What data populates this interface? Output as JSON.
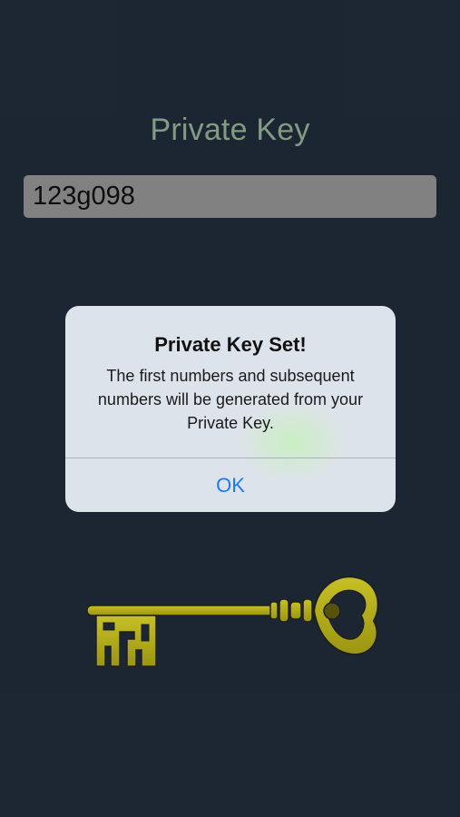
{
  "screen": {
    "title": "Private Key",
    "private_key_value": "123g098"
  },
  "alert": {
    "title": "Private Key Set!",
    "message": "The first numbers and subsequent numbers will be generated from your Private Key.",
    "ok_label": "OK"
  },
  "colors": {
    "background": "#1f2a38",
    "title": "#8fa88f",
    "field": "#8c8c8c",
    "alert_bg": "#dde3ea",
    "alert_button": "#1a7cf5",
    "key": "#c9c21a"
  },
  "icons": {
    "key_illustration": "skeleton-key-icon"
  }
}
